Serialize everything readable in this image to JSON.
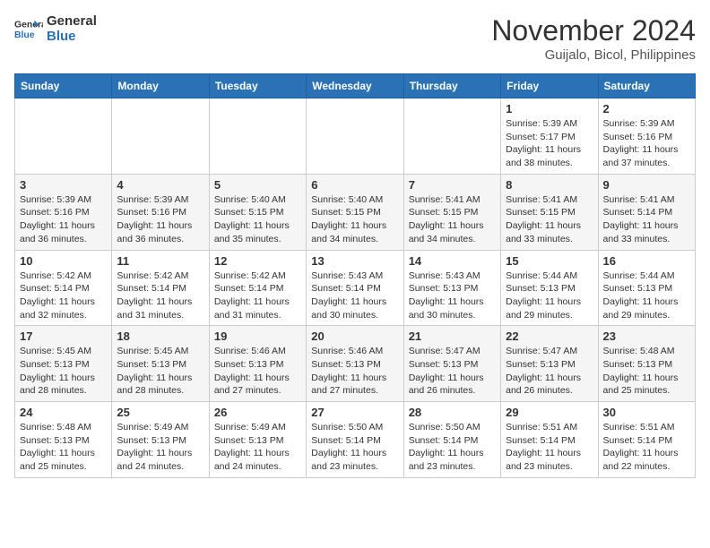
{
  "header": {
    "logo_line1": "General",
    "logo_line2": "Blue",
    "month": "November 2024",
    "location": "Guijalo, Bicol, Philippines"
  },
  "weekdays": [
    "Sunday",
    "Monday",
    "Tuesday",
    "Wednesday",
    "Thursday",
    "Friday",
    "Saturday"
  ],
  "weeks": [
    [
      {
        "day": "",
        "info": ""
      },
      {
        "day": "",
        "info": ""
      },
      {
        "day": "",
        "info": ""
      },
      {
        "day": "",
        "info": ""
      },
      {
        "day": "",
        "info": ""
      },
      {
        "day": "1",
        "info": "Sunrise: 5:39 AM\nSunset: 5:17 PM\nDaylight: 11 hours\nand 38 minutes."
      },
      {
        "day": "2",
        "info": "Sunrise: 5:39 AM\nSunset: 5:16 PM\nDaylight: 11 hours\nand 37 minutes."
      }
    ],
    [
      {
        "day": "3",
        "info": "Sunrise: 5:39 AM\nSunset: 5:16 PM\nDaylight: 11 hours\nand 36 minutes."
      },
      {
        "day": "4",
        "info": "Sunrise: 5:39 AM\nSunset: 5:16 PM\nDaylight: 11 hours\nand 36 minutes."
      },
      {
        "day": "5",
        "info": "Sunrise: 5:40 AM\nSunset: 5:15 PM\nDaylight: 11 hours\nand 35 minutes."
      },
      {
        "day": "6",
        "info": "Sunrise: 5:40 AM\nSunset: 5:15 PM\nDaylight: 11 hours\nand 34 minutes."
      },
      {
        "day": "7",
        "info": "Sunrise: 5:41 AM\nSunset: 5:15 PM\nDaylight: 11 hours\nand 34 minutes."
      },
      {
        "day": "8",
        "info": "Sunrise: 5:41 AM\nSunset: 5:15 PM\nDaylight: 11 hours\nand 33 minutes."
      },
      {
        "day": "9",
        "info": "Sunrise: 5:41 AM\nSunset: 5:14 PM\nDaylight: 11 hours\nand 33 minutes."
      }
    ],
    [
      {
        "day": "10",
        "info": "Sunrise: 5:42 AM\nSunset: 5:14 PM\nDaylight: 11 hours\nand 32 minutes."
      },
      {
        "day": "11",
        "info": "Sunrise: 5:42 AM\nSunset: 5:14 PM\nDaylight: 11 hours\nand 31 minutes."
      },
      {
        "day": "12",
        "info": "Sunrise: 5:42 AM\nSunset: 5:14 PM\nDaylight: 11 hours\nand 31 minutes."
      },
      {
        "day": "13",
        "info": "Sunrise: 5:43 AM\nSunset: 5:14 PM\nDaylight: 11 hours\nand 30 minutes."
      },
      {
        "day": "14",
        "info": "Sunrise: 5:43 AM\nSunset: 5:13 PM\nDaylight: 11 hours\nand 30 minutes."
      },
      {
        "day": "15",
        "info": "Sunrise: 5:44 AM\nSunset: 5:13 PM\nDaylight: 11 hours\nand 29 minutes."
      },
      {
        "day": "16",
        "info": "Sunrise: 5:44 AM\nSunset: 5:13 PM\nDaylight: 11 hours\nand 29 minutes."
      }
    ],
    [
      {
        "day": "17",
        "info": "Sunrise: 5:45 AM\nSunset: 5:13 PM\nDaylight: 11 hours\nand 28 minutes."
      },
      {
        "day": "18",
        "info": "Sunrise: 5:45 AM\nSunset: 5:13 PM\nDaylight: 11 hours\nand 28 minutes."
      },
      {
        "day": "19",
        "info": "Sunrise: 5:46 AM\nSunset: 5:13 PM\nDaylight: 11 hours\nand 27 minutes."
      },
      {
        "day": "20",
        "info": "Sunrise: 5:46 AM\nSunset: 5:13 PM\nDaylight: 11 hours\nand 27 minutes."
      },
      {
        "day": "21",
        "info": "Sunrise: 5:47 AM\nSunset: 5:13 PM\nDaylight: 11 hours\nand 26 minutes."
      },
      {
        "day": "22",
        "info": "Sunrise: 5:47 AM\nSunset: 5:13 PM\nDaylight: 11 hours\nand 26 minutes."
      },
      {
        "day": "23",
        "info": "Sunrise: 5:48 AM\nSunset: 5:13 PM\nDaylight: 11 hours\nand 25 minutes."
      }
    ],
    [
      {
        "day": "24",
        "info": "Sunrise: 5:48 AM\nSunset: 5:13 PM\nDaylight: 11 hours\nand 25 minutes."
      },
      {
        "day": "25",
        "info": "Sunrise: 5:49 AM\nSunset: 5:13 PM\nDaylight: 11 hours\nand 24 minutes."
      },
      {
        "day": "26",
        "info": "Sunrise: 5:49 AM\nSunset: 5:13 PM\nDaylight: 11 hours\nand 24 minutes."
      },
      {
        "day": "27",
        "info": "Sunrise: 5:50 AM\nSunset: 5:14 PM\nDaylight: 11 hours\nand 23 minutes."
      },
      {
        "day": "28",
        "info": "Sunrise: 5:50 AM\nSunset: 5:14 PM\nDaylight: 11 hours\nand 23 minutes."
      },
      {
        "day": "29",
        "info": "Sunrise: 5:51 AM\nSunset: 5:14 PM\nDaylight: 11 hours\nand 23 minutes."
      },
      {
        "day": "30",
        "info": "Sunrise: 5:51 AM\nSunset: 5:14 PM\nDaylight: 11 hours\nand 22 minutes."
      }
    ]
  ]
}
